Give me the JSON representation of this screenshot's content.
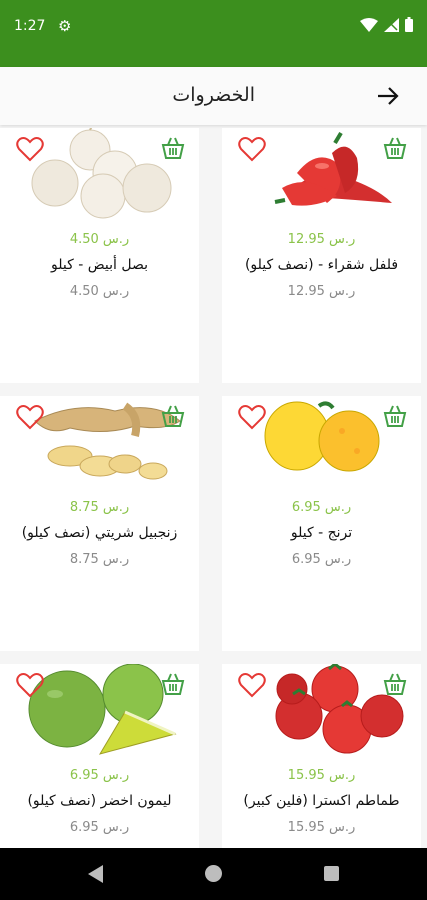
{
  "status": {
    "time": "1:27"
  },
  "header": {
    "title": "الخضروات"
  },
  "colors": {
    "brand_green": "#3c8f1e",
    "price_green": "#8bc34a",
    "heart_red": "#e53935",
    "cart_green": "#43a047"
  },
  "products": [
    {
      "price": "12.95 ر.س",
      "name": "فلفل شقراء - (نصف كيلو)",
      "old_price": "12.95 ر.س",
      "image": "red-peppers"
    },
    {
      "price": "4.50 ر.س",
      "name": "بصل أبيض - كيلو",
      "old_price": "4.50 ر.س",
      "image": "white-onions"
    },
    {
      "price": "6.95 ر.س",
      "name": "ترنج - كيلو",
      "old_price": "6.95 ر.س",
      "image": "citron"
    },
    {
      "price": "8.75 ر.س",
      "name": "زنجبيل شريتي (نصف كيلو)",
      "old_price": "8.75 ر.س",
      "image": "ginger"
    },
    {
      "price": "15.95 ر.س",
      "name": "طماطم اكسترا (فلين كبير)",
      "old_price": "15.95 ر.س",
      "image": "tomatoes"
    },
    {
      "price": "6.95 ر.س",
      "name": "ليمون اخضر (نصف كيلو)",
      "old_price": "6.95 ر.س",
      "image": "green-limes"
    }
  ]
}
